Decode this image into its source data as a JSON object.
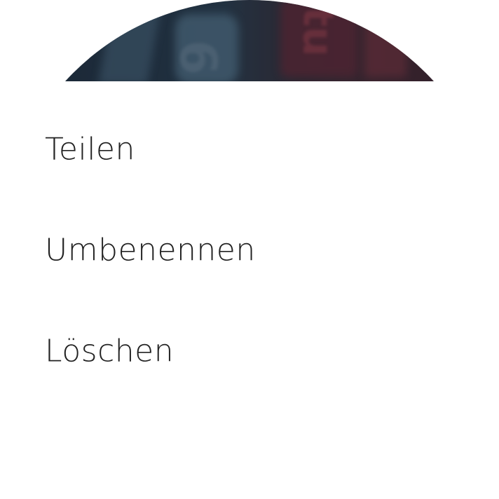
{
  "header": {
    "image": "photo-thumbnail"
  },
  "menu": {
    "items": [
      {
        "label": "Teilen"
      },
      {
        "label": "Umbenennen"
      },
      {
        "label": "Löschen"
      }
    ]
  },
  "colors": {
    "background": "#ffffff",
    "text": "#222222"
  }
}
